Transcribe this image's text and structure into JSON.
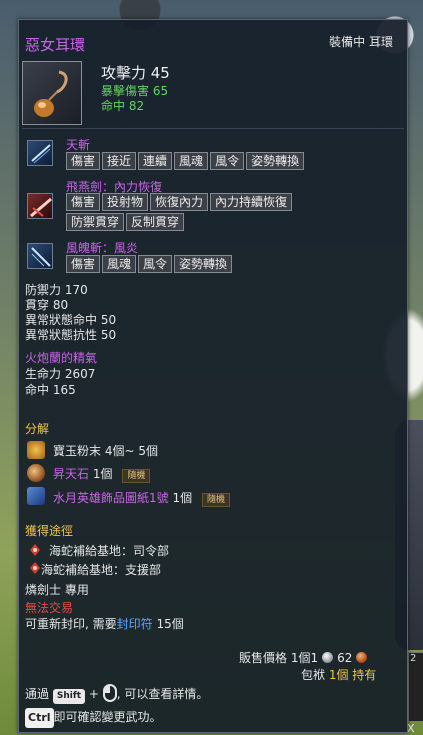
{
  "item": {
    "name": "惡女耳環",
    "status": "裝備中  耳環",
    "attack": "攻擊力  45",
    "crit_damage": "暴擊傷害  65",
    "accuracy": "命中  82",
    "icon": "earring-icon"
  },
  "skills": [
    {
      "name": "天斬",
      "icon": "sword-slash-icon",
      "color": "#2d4b73",
      "tags": [
        "傷害",
        "接近",
        "連續",
        "風魂",
        "風令",
        "姿勢轉換"
      ]
    },
    {
      "name": "飛燕劍：內力恢復",
      "icon": "flying-swallow-icon",
      "color": "#7a2a2a",
      "tags": [
        "傷害",
        "投射物",
        "恢復內力",
        "內力持續恢復"
      ],
      "tags2": [
        "防禦貫穿",
        "反制貫穿"
      ]
    },
    {
      "name": "風魄斬：風炎",
      "icon": "wind-slash-icon",
      "color": "#2d4b73",
      "tags": [
        "傷害",
        "風魂",
        "風令",
        "姿勢轉換"
      ]
    }
  ],
  "stats": {
    "defense": "防禦力  170",
    "pierce": "貫穿  80",
    "status_hit": "異常狀態命中  50",
    "status_resist": "異常狀態抗性  50"
  },
  "essence": {
    "title": "火炮蘭的精氣",
    "hp": "生命力  2607",
    "accuracy": "命中  165"
  },
  "decompose": {
    "title": "分解",
    "materials": [
      {
        "icon": "jade-powder-icon",
        "name": "寶玉粉末",
        "qty": "4個~ 5個",
        "badge": ""
      },
      {
        "icon": "ascension-stone-icon",
        "name": "昇天石",
        "qty": "1個",
        "badge": "隨機"
      },
      {
        "icon": "design-scroll-icon",
        "name": "水月英雄飾品圖紙1號",
        "qty": "1個",
        "badge": "隨機"
      }
    ]
  },
  "acquire": {
    "title": "獲得途徑",
    "routes": [
      "海蛇補給基地：司令部",
      "海蛇補給基地：支援部"
    ],
    "class_only": "燐劍士  專用",
    "no_trade": "無法交易",
    "reseal_prefix": "可重新封印, 需要",
    "reseal_item": "封印符",
    "reseal_qty": "  15個"
  },
  "sell": {
    "label": "販售價格  1個1",
    "silver": "62",
    "bag": "包袱  ",
    "bag_count": "1個  持有"
  },
  "hints": {
    "line1_prefix": "通過",
    "shift_key": "Shift",
    "plus": "+",
    "line1_suffix": ", 可以查看詳情。",
    "ctrl_key": "Ctrl",
    "line2": "即可確認變更武功。"
  },
  "side": {
    "slot_number": "2",
    "close": "X"
  }
}
